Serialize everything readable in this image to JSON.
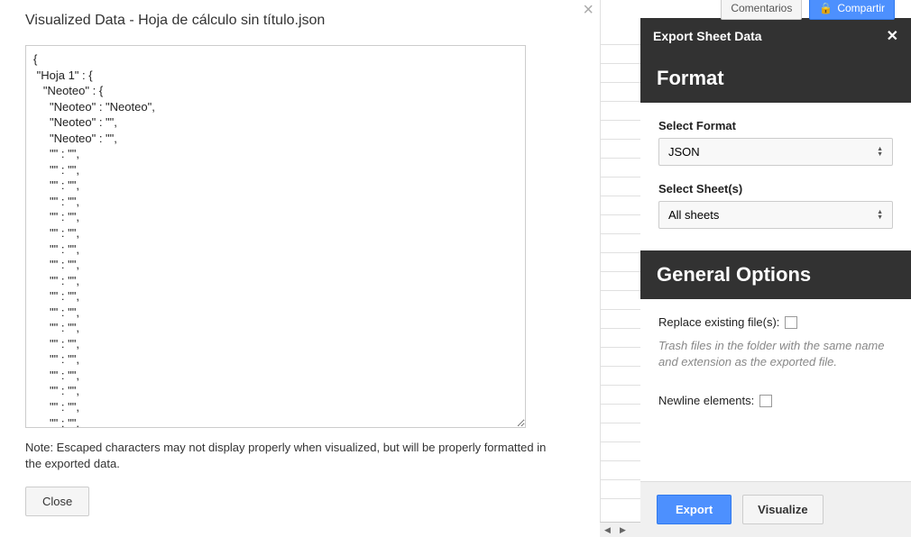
{
  "modal": {
    "title": "Visualized Data - Hoja de cálculo sin título.json",
    "json_content": "{\n \"Hoja 1\" : {\n   \"Neoteo\" : {\n     \"Neoteo\" : \"Neoteo\",\n     \"Neoteo\" : \"\",\n     \"Neoteo\" : \"\",\n     \"\" : \"\",\n     \"\" : \"\",\n     \"\" : \"\",\n     \"\" : \"\",\n     \"\" : \"\",\n     \"\" : \"\",\n     \"\" : \"\",\n     \"\" : \"\",\n     \"\" : \"\",\n     \"\" : \"\",\n     \"\" : \"\",\n     \"\" : \"\",\n     \"\" : \"\",\n     \"\" : \"\",\n     \"\" : \"\",\n     \"\" : \"\",\n     \"\" : \"\",\n     \"\" : \"\",\n     \"\" : \"\",\n     \"\" : \"\",\n     \"\" : \"\",\n     \"\" : \"\",\n     \"\" : \"\",\n     \"\" : \"\",",
    "note": "Note: Escaped characters may not display properly when visualized, but will be properly formatted in the exported data.",
    "close_label": "Close"
  },
  "top_buttons": {
    "comentarios": "Comentarios",
    "compartir": "Compartir"
  },
  "sidebar": {
    "title": "Export Sheet Data",
    "sections": {
      "format": {
        "heading": "Format",
        "select_format_label": "Select Format",
        "select_format_value": "JSON",
        "select_sheet_label": "Select Sheet(s)",
        "select_sheet_value": "All sheets"
      },
      "general": {
        "heading": "General Options",
        "replace_label": "Replace existing file(s):",
        "replace_desc": "Trash files in the folder with the same name and extension as the exported file.",
        "newline_label": "Newline elements:"
      }
    },
    "footer": {
      "export_label": "Export",
      "visualize_label": "Visualize"
    }
  }
}
